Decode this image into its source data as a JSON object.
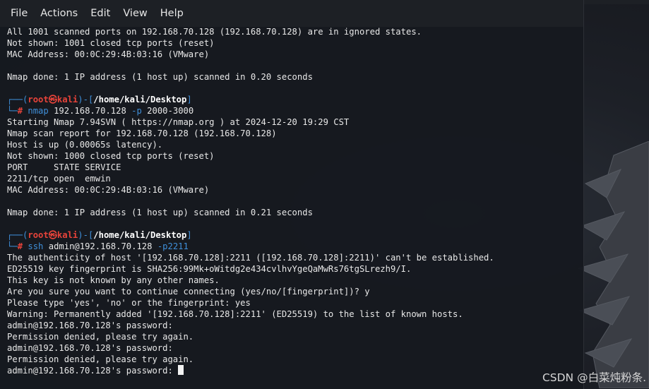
{
  "menu": {
    "file": "File",
    "actions": "Actions",
    "edit": "Edit",
    "view": "View",
    "help": "Help"
  },
  "output1": [
    "All 1001 scanned ports on 192.168.70.128 (192.168.70.128) are in ignored states.",
    "Not shown: 1001 closed tcp ports (reset)",
    "MAC Address: 00:0C:29:4B:03:16 (VMware)",
    "",
    "Nmap done: 1 IP address (1 host up) scanned in 0.20 seconds",
    ""
  ],
  "prompt": {
    "line_start": "┌──(",
    "user": "root",
    "at_icon": "㉿",
    "host": "kali",
    "mid": ")-[",
    "path": "/home/kali/Desktop",
    "end": "]",
    "line2_start": "└─",
    "hash": "#"
  },
  "cmd1": {
    "program": "nmap",
    "args": " 192.168.70.128 ",
    "flag": "-p",
    "value": " 2000-3000"
  },
  "output2": [
    "Starting Nmap 7.94SVN ( https://nmap.org ) at 2024-12-20 19:29 CST",
    "Nmap scan report for 192.168.70.128 (192.168.70.128)",
    "Host is up (0.00065s latency).",
    "Not shown: 1000 closed tcp ports (reset)",
    "PORT     STATE SERVICE",
    "2211/tcp open  emwin",
    "MAC Address: 00:0C:29:4B:03:16 (VMware)",
    "",
    "Nmap done: 1 IP address (1 host up) scanned in 0.21 seconds",
    ""
  ],
  "cmd2": {
    "program": "ssh",
    "args": " admin@192.168.70.128 ",
    "flag": "-p2211"
  },
  "output3": [
    "The authenticity of host '[192.168.70.128]:2211 ([192.168.70.128]:2211)' can't be established.",
    "ED25519 key fingerprint is SHA256:99Mk+oWitdg2e434cvlhvYgeQaMwRs76tgSLrezh9/I.",
    "This key is not known by any other names.",
    "Are you sure you want to continue connecting (yes/no/[fingerprint])? y",
    "Please type 'yes', 'no' or the fingerprint: yes",
    "Warning: Permanently added '[192.168.70.128]:2211' (ED25519) to the list of known hosts.",
    "admin@192.168.70.128's password:",
    "Permission denied, please try again.",
    "admin@192.168.70.128's password:",
    "Permission denied, please try again."
  ],
  "last_line": "admin@192.168.70.128's password: ",
  "watermark": "CSDN @白菜炖粉条.",
  "colors": {
    "prompt_blue": "#3f8fd9",
    "prompt_red": "#e8433a",
    "terminal_bg": "#16191f"
  }
}
